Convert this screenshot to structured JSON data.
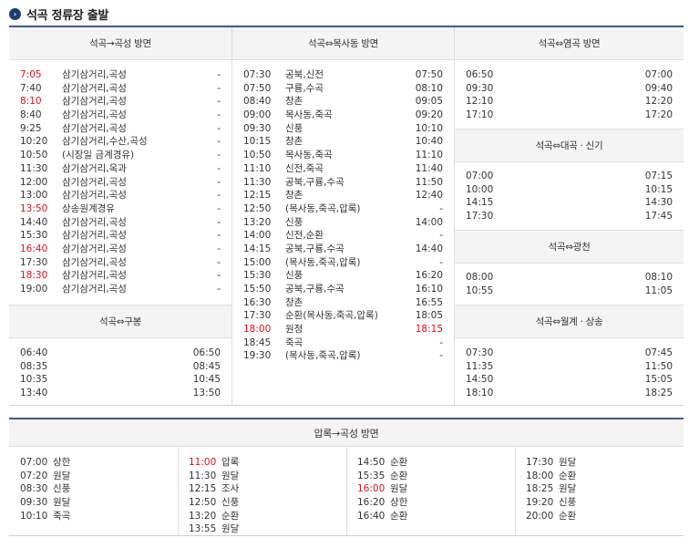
{
  "header": {
    "bullet": "›",
    "title": "석곡 정류장 출발"
  },
  "sections": {
    "gokseong": {
      "title": "석곡→곡성 방면",
      "rows": [
        {
          "time": "7:05",
          "route": "삼기삼거리,곡성",
          "end": "-",
          "red": true
        },
        {
          "time": "7:40",
          "route": "삼기삼거리,곡성",
          "end": "-"
        },
        {
          "time": "8:10",
          "route": "삼기삼거리,곡성",
          "end": "-",
          "red": true
        },
        {
          "time": "8:40",
          "route": "삼기삼거리,곡성",
          "end": "-"
        },
        {
          "time": "9:25",
          "route": "삼기삼거리,곡성",
          "end": "-"
        },
        {
          "time": "10:20",
          "route": "삼기삼거리,수산,곡성",
          "end": "-"
        },
        {
          "time": "10:50",
          "route": "(시장일 금계경유)",
          "end": "-"
        },
        {
          "time": "11:30",
          "route": "삼기삼거리,옥과",
          "end": "-"
        },
        {
          "time": "12:00",
          "route": "삼기삼거리,곡성",
          "end": "-"
        },
        {
          "time": "13:00",
          "route": "삼기삼거리,곡성",
          "end": "-"
        },
        {
          "time": "13:50",
          "route": "상송원계경유",
          "end": "-",
          "red": true
        },
        {
          "time": "14:40",
          "route": "삼기삼거리,곡성",
          "end": "-"
        },
        {
          "time": "15:30",
          "route": "삼기삼거리,곡성",
          "end": "-"
        },
        {
          "time": "16:40",
          "route": "삼기삼거리,곡성",
          "end": "-",
          "red": true
        },
        {
          "time": "17:30",
          "route": "삼기삼거리,곡성",
          "end": "-"
        },
        {
          "time": "18:30",
          "route": "삼기삼거리,곡성",
          "end": "-",
          "red": true
        },
        {
          "time": "19:00",
          "route": "삼기삼거리,곡성",
          "end": "-"
        }
      ]
    },
    "gubong": {
      "title": "석곡⇔구봉",
      "rows": [
        {
          "dep": "06:40",
          "ret": "06:50"
        },
        {
          "dep": "08:35",
          "ret": "08:45"
        },
        {
          "dep": "10:35",
          "ret": "10:45"
        },
        {
          "dep": "13:40",
          "ret": "13:50"
        }
      ]
    },
    "moksadong": {
      "title": "석곡⇔목사동 방면",
      "rows": [
        {
          "time": "07:30",
          "route": "공북,신전",
          "ret": "07:50"
        },
        {
          "time": "07:50",
          "route": "구룡,수곡",
          "ret": "08:10"
        },
        {
          "time": "08:40",
          "route": "창촌",
          "ret": "09:05"
        },
        {
          "time": "09:00",
          "route": "목사동,죽곡",
          "ret": "09:20"
        },
        {
          "time": "09:30",
          "route": "신풍",
          "ret": "10:10"
        },
        {
          "time": "10:15",
          "route": "창촌",
          "ret": "10:40"
        },
        {
          "time": "10:50",
          "route": "목사동,죽곡",
          "ret": "11:10"
        },
        {
          "time": "11:10",
          "route": "신전,죽곡",
          "ret": "11:40"
        },
        {
          "time": "11:30",
          "route": "공북,구룡,수곡",
          "ret": "11:50"
        },
        {
          "time": "12:15",
          "route": "창촌",
          "ret": "12:40"
        },
        {
          "time": "12:50",
          "route": "(목사동,죽곡,압록)",
          "ret": "-"
        },
        {
          "time": "13:20",
          "route": "신풍",
          "ret": "14:00"
        },
        {
          "time": "14:00",
          "route": "신전,순환",
          "ret": "-"
        },
        {
          "time": "14:15",
          "route": "공북,구룡,수곡",
          "ret": "14:40"
        },
        {
          "time": "15:00",
          "route": "(목사동,죽곡,압록)",
          "ret": "-"
        },
        {
          "time": "15:30",
          "route": "신풍",
          "ret": "16:20"
        },
        {
          "time": "15:50",
          "route": "공북,구룡,수곡",
          "ret": "16:10"
        },
        {
          "time": "16:30",
          "route": "창촌",
          "ret": "16:55"
        },
        {
          "time": "17:30",
          "route": "순환(목사동,죽곡,압록)",
          "ret": "18:05"
        },
        {
          "time": "18:00",
          "route": "원정",
          "ret": "18:15",
          "red": true
        },
        {
          "time": "18:45",
          "route": "죽곡",
          "ret": "-"
        },
        {
          "time": "19:30",
          "route": "(목사동,죽곡,압록)",
          "ret": "-"
        }
      ]
    },
    "yeomgok": {
      "title": "석곡⇔염곡 방면",
      "rows": [
        {
          "dep": "06:50",
          "ret": "07:00"
        },
        {
          "dep": "09:30",
          "ret": "09:40"
        },
        {
          "dep": "12:10",
          "ret": "12:20"
        },
        {
          "dep": "17:10",
          "ret": "17:20"
        }
      ]
    },
    "daegok": {
      "title": "석곡⇔대곡 · 신기",
      "rows": [
        {
          "dep": "07:00",
          "ret": "07:15"
        },
        {
          "dep": "10:00",
          "ret": "10:15"
        },
        {
          "dep": "14:15",
          "ret": "14:30"
        },
        {
          "dep": "17:30",
          "ret": "17:45"
        }
      ]
    },
    "gwangcheon": {
      "title": "석곡⇔광천",
      "rows": [
        {
          "dep": "08:00",
          "ret": "08:10"
        },
        {
          "dep": "10:55",
          "ret": "11:05"
        }
      ]
    },
    "wolgye": {
      "title": "석곡⇔월계 · 상송",
      "rows": [
        {
          "dep": "07:30",
          "ret": "07:45"
        },
        {
          "dep": "11:35",
          "ret": "11:50"
        },
        {
          "dep": "14:50",
          "ret": "15:05"
        },
        {
          "dep": "18:10",
          "ret": "18:25"
        }
      ]
    },
    "aprok": {
      "title": "압록→곡성 방면",
      "columns": [
        [
          {
            "time": "07:00",
            "route": "상한"
          },
          {
            "time": "07:20",
            "route": "원달"
          },
          {
            "time": "08:30",
            "route": "신풍"
          },
          {
            "time": "09:30",
            "route": "원달"
          },
          {
            "time": "10:10",
            "route": "죽곡"
          }
        ],
        [
          {
            "time": "11:00",
            "route": "압록",
            "red": true
          },
          {
            "time": "11:30",
            "route": "원달"
          },
          {
            "time": "12:15",
            "route": "조사"
          },
          {
            "time": "12:50",
            "route": "신풍"
          },
          {
            "time": "13:20",
            "route": "순환"
          },
          {
            "time": "13:55",
            "route": "원달"
          }
        ],
        [
          {
            "time": "14:50",
            "route": "순환"
          },
          {
            "time": "15:35",
            "route": "순환"
          },
          {
            "time": "16:00",
            "route": "원달",
            "red": true
          },
          {
            "time": "16:20",
            "route": "상한"
          },
          {
            "time": "16:40",
            "route": "순환"
          }
        ],
        [
          {
            "time": "17:30",
            "route": "원달"
          },
          {
            "time": "18:00",
            "route": "순환"
          },
          {
            "time": "18:25",
            "route": "원달"
          },
          {
            "time": "19:20",
            "route": "신풍"
          },
          {
            "time": "20:00",
            "route": "순환"
          }
        ]
      ]
    }
  }
}
